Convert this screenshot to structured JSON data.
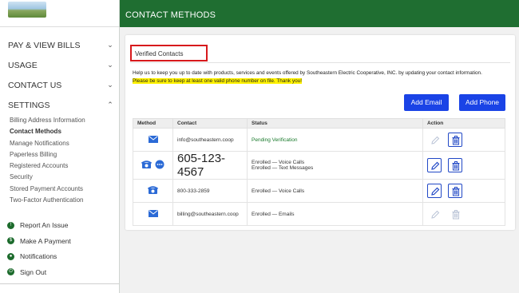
{
  "page": {
    "title": "CONTACT METHODS"
  },
  "colors": {
    "brand_green": "#1f6e31",
    "accent_blue": "#1a43e6",
    "highlight": "#fff200",
    "alert_red": "#d7191c"
  },
  "sidebar": {
    "sections": [
      {
        "label": "PAY & VIEW BILLS",
        "expanded": false
      },
      {
        "label": "USAGE",
        "expanded": false
      },
      {
        "label": "CONTACT US",
        "expanded": false
      },
      {
        "label": "SETTINGS",
        "expanded": true
      }
    ],
    "settings_items": [
      "Billing Address Information",
      "Contact Methods",
      "Manage Notifications",
      "Paperless Billing",
      "Registered Accounts",
      "Security",
      "Stored Payment Accounts",
      "Two-Factor Authentication"
    ],
    "active_item": "Contact Methods",
    "utilities": [
      {
        "label": "Report An Issue",
        "icon": "alert-icon"
      },
      {
        "label": "Make A Payment",
        "icon": "dollar-icon"
      },
      {
        "label": "Notifications",
        "icon": "bell-icon"
      },
      {
        "label": "Sign Out",
        "icon": "power-icon"
      }
    ]
  },
  "card": {
    "tab_label": "Verified Contacts",
    "description": "Help us to keep you up to date with products, services and events offered by Southeastern Electric Cooperative, INC. by updating your contact information.",
    "warning": "Please be sure to keep at least one valid phone number on file. Thank you!",
    "add_email_label": "Add Email",
    "add_phone_label": "Add Phone"
  },
  "table": {
    "headers": [
      "Method",
      "Contact",
      "Status",
      "Action"
    ],
    "rows": [
      {
        "icons": [
          "mail-icon"
        ],
        "contact": "info@southeastern.coop",
        "status": [
          "Pending Verification"
        ],
        "editable": false
      },
      {
        "icons": [
          "phone-icon",
          "chat-icon"
        ],
        "contact": "605-123-4567",
        "status": [
          "Enrolled — Voice Calls",
          "Enrolled — Text Messages"
        ],
        "editable": true
      },
      {
        "icons": [
          "phone-icon"
        ],
        "contact": "800-333-2859",
        "status": [
          "Enrolled — Voice Calls"
        ],
        "editable": true
      },
      {
        "icons": [
          "mail-icon"
        ],
        "contact": "billing@southeastern.coop",
        "status": [
          "Enrolled — Emails"
        ],
        "editable": false
      }
    ]
  }
}
